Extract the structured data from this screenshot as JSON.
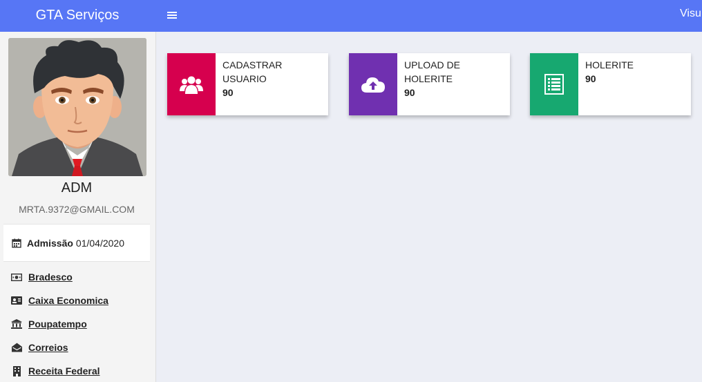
{
  "header": {
    "brand": "GTA Serviços",
    "right_text": "Visu",
    "accent": "#5776f5"
  },
  "profile": {
    "name": "ADM",
    "email": "MRTA.9372@GMAIL.COM",
    "admission_label": "Admissão",
    "admission_date": "01/04/2020"
  },
  "links": [
    {
      "label": "Bradesco",
      "icon": "money-bill-icon"
    },
    {
      "label": "Caixa Economica",
      "icon": "id-card-icon"
    },
    {
      "label": "Poupatempo",
      "icon": "bank-icon"
    },
    {
      "label": "Correios",
      "icon": "envelope-open-icon"
    },
    {
      "label": "Receita Federal",
      "icon": "building-icon"
    }
  ],
  "cards": [
    {
      "line1": "CADASTRAR",
      "line2": "USUARIO",
      "value": "90",
      "color": "#d6004e",
      "icon": "users-icon"
    },
    {
      "line1": "UPLOAD DE",
      "line2": "HOLERITE",
      "value": "90",
      "color": "#7030b0",
      "icon": "cloud-upload-icon"
    },
    {
      "line1": "HOLERITE",
      "line2": "",
      "value": "90",
      "color": "#17a870",
      "icon": "list-document-icon"
    }
  ]
}
